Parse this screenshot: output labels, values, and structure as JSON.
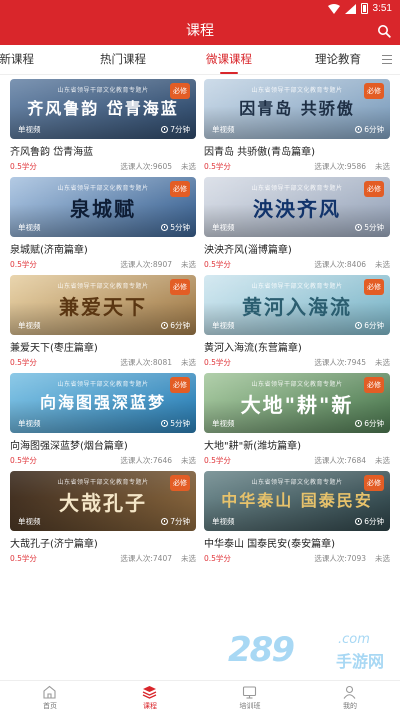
{
  "status_bar": {
    "time": "3:51"
  },
  "app_bar": {
    "title": "课程"
  },
  "tabs": [
    {
      "label": "最新课程",
      "active": false
    },
    {
      "label": "热门课程",
      "active": false
    },
    {
      "label": "微课课程",
      "active": true
    },
    {
      "label": "理论教育",
      "active": false
    }
  ],
  "course_common": {
    "series": "山东省领导干部文化教育专题片",
    "badge": "必修",
    "single_video": "单视频"
  },
  "courses": [
    {
      "title": "齐风鲁韵 岱青海蓝",
      "calligraphy": "齐风鲁韵 岱青海蓝",
      "duration": "7分钟",
      "credit": "0.5学分",
      "enrolled": "选课人次:9605",
      "status": "未选",
      "colors": [
        "#6a86a8",
        "#2f4a6b"
      ],
      "ink": "#ffffff"
    },
    {
      "title": "因青岛 共骄傲(青岛篇章)",
      "calligraphy": "因青岛 共骄傲",
      "duration": "6分钟",
      "credit": "0.5学分",
      "enrolled": "选课人次:9586",
      "status": "未选",
      "colors": [
        "#c7d7e6",
        "#7f9fbe"
      ],
      "ink": "#1e2f45"
    },
    {
      "title": "泉城赋(济南篇章)",
      "calligraphy": "泉城赋",
      "duration": "5分钟",
      "credit": "0.5学分",
      "enrolled": "选课人次:8907",
      "status": "未选",
      "colors": [
        "#a9c3e0",
        "#3b6291"
      ],
      "ink": "#0e1d35"
    },
    {
      "title": "泱泱齐风(淄博篇章)",
      "calligraphy": "泱泱齐风",
      "duration": "5分钟",
      "credit": "0.5学分",
      "enrolled": "选课人次:8406",
      "status": "未选",
      "colors": [
        "#d8dde6",
        "#9aa7bc"
      ],
      "ink": "#12346b"
    },
    {
      "title": "兼爱天下(枣庄篇章)",
      "calligraphy": "兼爱天下",
      "duration": "6分钟",
      "credit": "0.5学分",
      "enrolled": "选课人次:8081",
      "status": "未选",
      "colors": [
        "#e6cfa3",
        "#a17c4b"
      ],
      "ink": "#5a3612"
    },
    {
      "title": "黄河入海流(东营篇章)",
      "calligraphy": "黄河入海流",
      "duration": "6分钟",
      "credit": "0.5学分",
      "enrolled": "选课人次:7945",
      "status": "未选",
      "colors": [
        "#cfe6ef",
        "#7eb7c9"
      ],
      "ink": "#2b5e70"
    },
    {
      "title": "向海图强深蓝梦(烟台篇章)",
      "calligraphy": "向海图强深蓝梦",
      "duration": "5分钟",
      "credit": "0.5学分",
      "enrolled": "选课人次:7646",
      "status": "未选",
      "colors": [
        "#7ec2e4",
        "#2c7fb5"
      ],
      "ink": "#ffffff"
    },
    {
      "title": "大地\"耕\"新(潍坊篇章)",
      "calligraphy": "大地\"耕\"新",
      "duration": "6分钟",
      "credit": "0.5学分",
      "enrolled": "选课人次:7684",
      "status": "未选",
      "colors": [
        "#a7c9a0",
        "#4e7a52"
      ],
      "ink": "#ffffff"
    },
    {
      "title": "大哉孔子(济宁篇章)",
      "calligraphy": "大哉孔子",
      "duration": "7分钟",
      "credit": "0.5学分",
      "enrolled": "选课人次:7407",
      "status": "未选",
      "colors": [
        "#3a2a1e",
        "#8e6a3f"
      ],
      "ink": "#f4e6c8"
    },
    {
      "title": "中华泰山 国泰民安(泰安篇章)",
      "calligraphy": "中华泰山 国泰民安",
      "duration": "6分钟",
      "credit": "0.5学分",
      "enrolled": "选课人次:7093",
      "status": "未选",
      "colors": [
        "#6f8a8e",
        "#2f4449"
      ],
      "ink": "#e7c26b"
    }
  ],
  "watermark": {
    "number": "289",
    "domain": ".com",
    "site": "手游网"
  },
  "bottom_nav": [
    {
      "label": "首页",
      "active": false
    },
    {
      "label": "课程",
      "active": true
    },
    {
      "label": "培训班",
      "active": false
    },
    {
      "label": "我的",
      "active": false
    }
  ]
}
